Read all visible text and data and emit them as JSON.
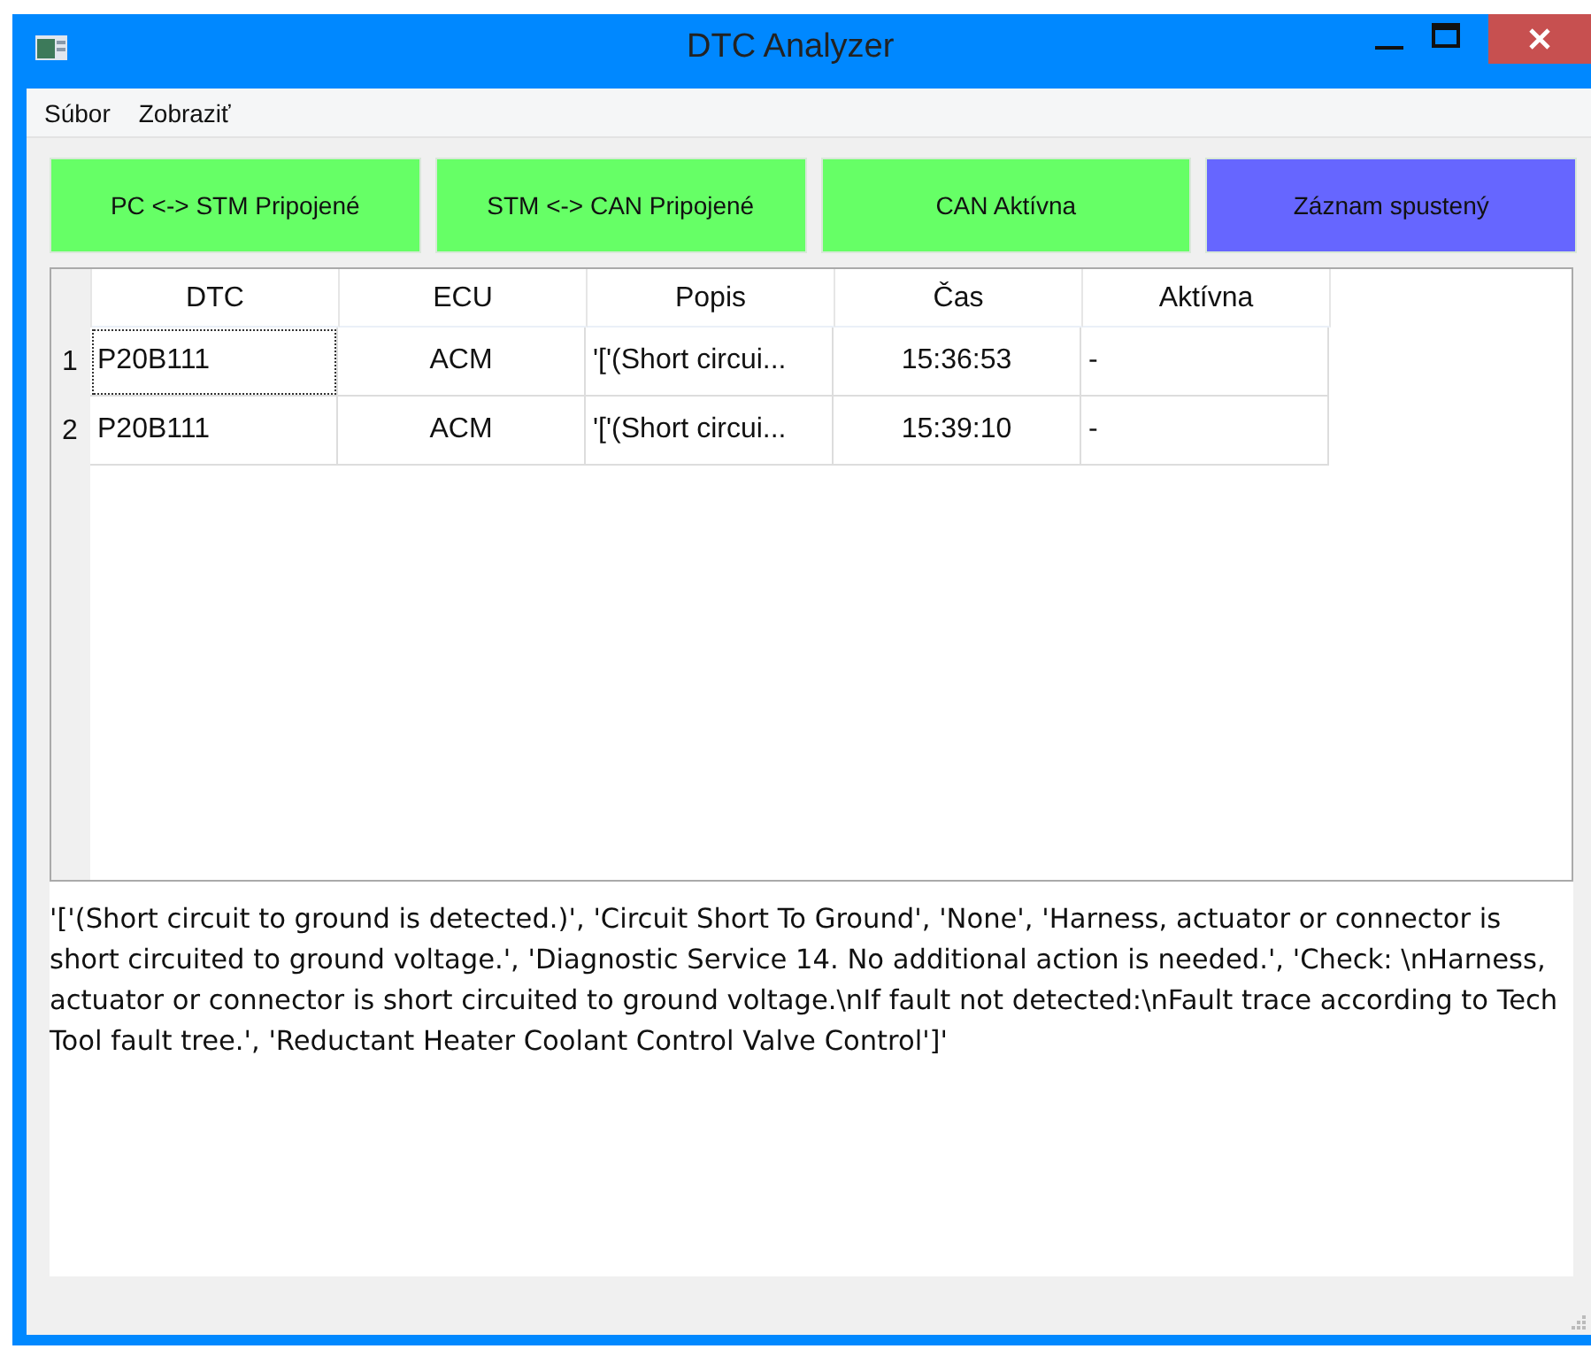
{
  "window": {
    "title": "DTC Analyzer"
  },
  "menu": [
    "Súbor",
    "Zobraziť"
  ],
  "status_buttons": [
    {
      "label": "PC <-> STM Pripojené",
      "color": "#66ff66"
    },
    {
      "label": "STM <-> CAN Pripojené",
      "color": "#66ff66"
    },
    {
      "label": "CAN Aktívna",
      "color": "#66ff66"
    },
    {
      "label": "Záznam spustený",
      "color": "#6666ff"
    }
  ],
  "table": {
    "columns": [
      "DTC",
      "ECU",
      "Popis",
      "Čas",
      "Aktívna"
    ],
    "rows": [
      {
        "number": "1",
        "cells": [
          "P20B111",
          "ACM",
          "'['(Short circui...",
          "15:36:53",
          "-"
        ],
        "focused": true
      },
      {
        "number": "2",
        "cells": [
          "P20B111",
          "ACM",
          "'['(Short circui...",
          "15:39:10",
          "-"
        ],
        "focused": false
      }
    ]
  },
  "detail_text": "'['(Short circuit to ground is detected.)', 'Circuit Short To Ground', 'None', 'Harness, actuator or connector is short circuited to ground voltage.', 'Diagnostic Service 14. No additional action is needed.', 'Check: \\nHarness, actuator or connector is short circuited to ground voltage.\\nIf fault not detected:\\nFault trace according to Tech Tool fault tree.', 'Reductant Heater Coolant Control Valve Control']'"
}
